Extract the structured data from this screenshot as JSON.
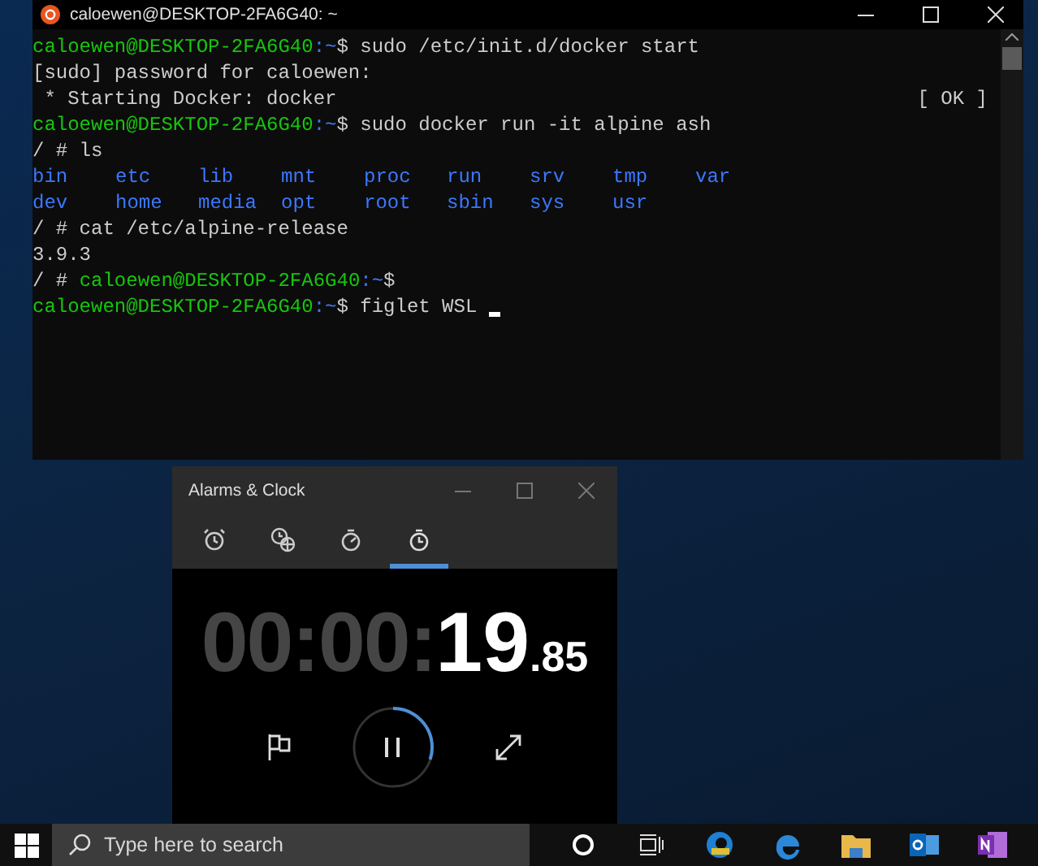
{
  "terminal": {
    "title": "caloewen@DESKTOP-2FA6G40: ~",
    "lines": [
      {
        "kind": "text",
        "segments": [
          {
            "text": "caloewen@DESKTOP-2FA6G40",
            "kind": "user"
          },
          {
            "text": ":~",
            "kind": "path"
          },
          {
            "text": "$ sudo /etc/init.d/docker start",
            "kind": "plain"
          }
        ]
      },
      {
        "kind": "text",
        "segments": [
          {
            "text": "[sudo] password for caloewen:",
            "kind": "plain"
          }
        ]
      },
      {
        "kind": "status",
        "segments": [
          {
            "text": " * Starting Docker: docker",
            "kind": "plain"
          }
        ],
        "status": "[ OK ]"
      },
      {
        "kind": "text",
        "segments": [
          {
            "text": "caloewen@DESKTOP-2FA6G40",
            "kind": "user"
          },
          {
            "text": ":~",
            "kind": "path"
          },
          {
            "text": "$ sudo docker run -it alpine ash",
            "kind": "plain"
          }
        ]
      },
      {
        "kind": "text",
        "segments": [
          {
            "text": "/ # ls",
            "kind": "plain"
          }
        ]
      },
      {
        "kind": "listing",
        "entries": [
          "bin",
          "etc",
          "lib",
          "mnt",
          "proc",
          "run",
          "srv",
          "tmp",
          "var"
        ]
      },
      {
        "kind": "listing",
        "entries": [
          "dev",
          "home",
          "media",
          "opt",
          "root",
          "sbin",
          "sys",
          "usr"
        ]
      },
      {
        "kind": "text",
        "segments": [
          {
            "text": "/ # cat /etc/alpine-release",
            "kind": "plain"
          }
        ]
      },
      {
        "kind": "text",
        "segments": [
          {
            "text": "3.9.3",
            "kind": "plain"
          }
        ]
      },
      {
        "kind": "text",
        "segments": [
          {
            "text": "/ # ",
            "kind": "plain"
          },
          {
            "text": "caloewen@DESKTOP-2FA6G40",
            "kind": "user"
          },
          {
            "text": ":~",
            "kind": "path"
          },
          {
            "text": "$",
            "kind": "plain"
          }
        ]
      },
      {
        "kind": "input",
        "segments": [
          {
            "text": "caloewen@DESKTOP-2FA6G40",
            "kind": "user"
          },
          {
            "text": ":~",
            "kind": "path"
          },
          {
            "text": "$ figlet WSL ",
            "kind": "plain"
          }
        ]
      }
    ]
  },
  "alarms": {
    "title": "Alarms & Clock",
    "tabs": [
      {
        "kind": "alarm",
        "selected": false
      },
      {
        "kind": "world",
        "selected": false
      },
      {
        "kind": "timer",
        "selected": false
      },
      {
        "kind": "stopwatch",
        "selected": true
      }
    ],
    "time": {
      "elapsed": "00:00:",
      "seconds": "19",
      "hundredths": ".85"
    },
    "ring": {
      "level": 0.3
    }
  },
  "taskbar": {
    "search": {
      "placeholder": "Type here to search"
    }
  }
}
